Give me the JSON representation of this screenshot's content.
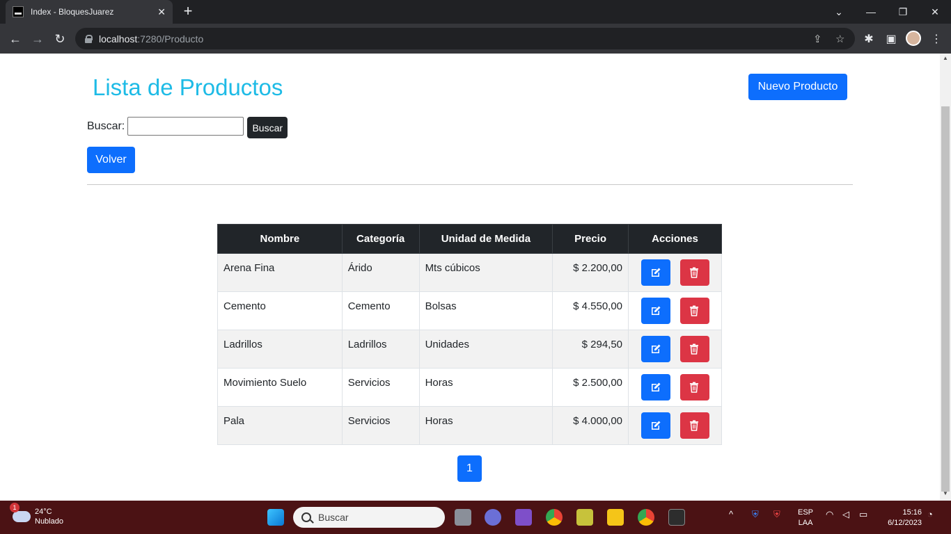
{
  "browser": {
    "tab_title": "Index - BloquesJuarez",
    "url_host": "localhost",
    "url_path": ":7280/Producto"
  },
  "page": {
    "title": "Lista de Productos",
    "new_button": "Nuevo Producto",
    "search_label": "Buscar:",
    "search_value": "",
    "search_button": "Buscar",
    "back_button": "Volver",
    "pagination_current": "1"
  },
  "table": {
    "headers": [
      "Nombre",
      "Categoría",
      "Unidad de Medida",
      "Precio",
      "Acciones"
    ],
    "rows": [
      {
        "nombre": "Arena Fina",
        "categoria": "Árido",
        "unidad": "Mts cúbicos",
        "precio": "$ 2.200,00"
      },
      {
        "nombre": "Cemento",
        "categoria": "Cemento",
        "unidad": "Bolsas",
        "precio": "$ 4.550,00"
      },
      {
        "nombre": "Ladrillos",
        "categoria": "Ladrillos",
        "unidad": "Unidades",
        "precio": "$ 294,50"
      },
      {
        "nombre": "Movimiento Suelo",
        "categoria": "Servicios",
        "unidad": "Horas",
        "precio": "$ 2.500,00"
      },
      {
        "nombre": "Pala",
        "categoria": "Servicios",
        "unidad": "Horas",
        "precio": "$ 4.000,00"
      }
    ]
  },
  "taskbar": {
    "weather_temp": "24°C",
    "weather_desc": "Nublado",
    "weather_badge": "1",
    "search_placeholder": "Buscar",
    "lang_1": "ESP",
    "lang_2": "LAA",
    "time": "15:16",
    "date": "6/12/2023"
  },
  "colors": {
    "primary": "#0d6efd",
    "danger": "#dc3545",
    "title": "#1ebbe6",
    "dark": "#212529"
  }
}
